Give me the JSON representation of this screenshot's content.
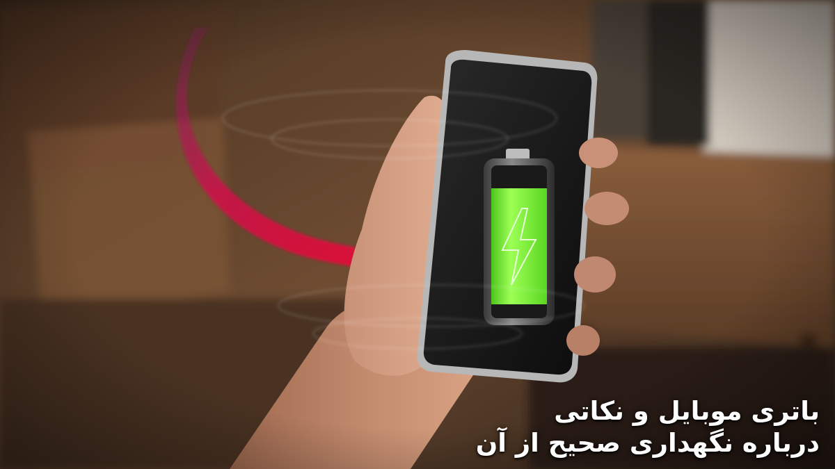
{
  "photo": {
    "subject": "hand holding smartphone showing charging battery with heart",
    "battery_charge_fraction": 0.76,
    "colors": {
      "battery_green": "#7cf03a",
      "heart_red": "#e8102e",
      "wood": "#7a5436",
      "screen": "#141414"
    }
  },
  "caption": {
    "line1": "باتری موبایل و نکاتی",
    "line2": "درباره نگهداری صحیح از آن"
  }
}
